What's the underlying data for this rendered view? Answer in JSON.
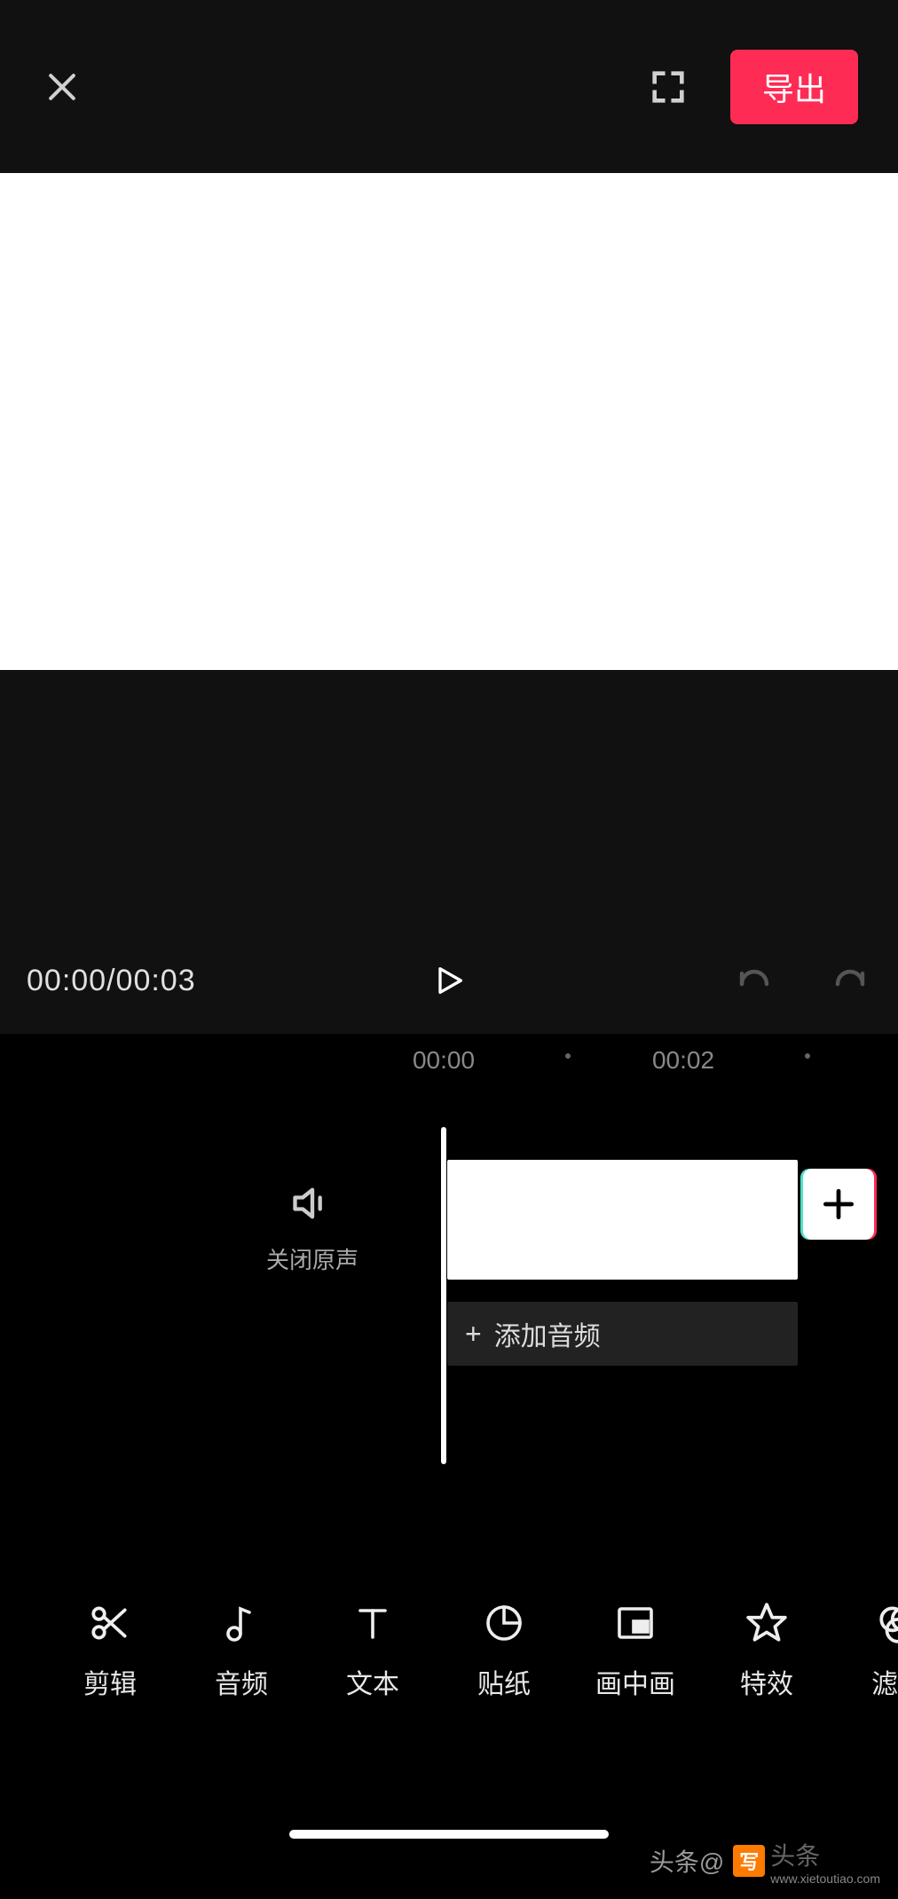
{
  "top": {
    "export_label": "导出"
  },
  "playback": {
    "time_display": "00:00/00:03"
  },
  "ruler": {
    "mark1": "00:00",
    "mark2": "00:02"
  },
  "timeline": {
    "mute_label": "关闭原声",
    "add_audio_label": "添加音频"
  },
  "tools": [
    {
      "label": "剪辑",
      "icon": "scissors-icon"
    },
    {
      "label": "音频",
      "icon": "music-note-icon"
    },
    {
      "label": "文本",
      "icon": "text-icon"
    },
    {
      "label": "贴纸",
      "icon": "sticker-icon"
    },
    {
      "label": "画中画",
      "icon": "pip-icon"
    },
    {
      "label": "特效",
      "icon": "star-icon"
    },
    {
      "label": "滤镜",
      "icon": "filter-icon"
    }
  ],
  "watermark": {
    "prefix": "头条@",
    "badge": "写",
    "brand": "头条",
    "sub": "www.xietoutiao.com"
  }
}
